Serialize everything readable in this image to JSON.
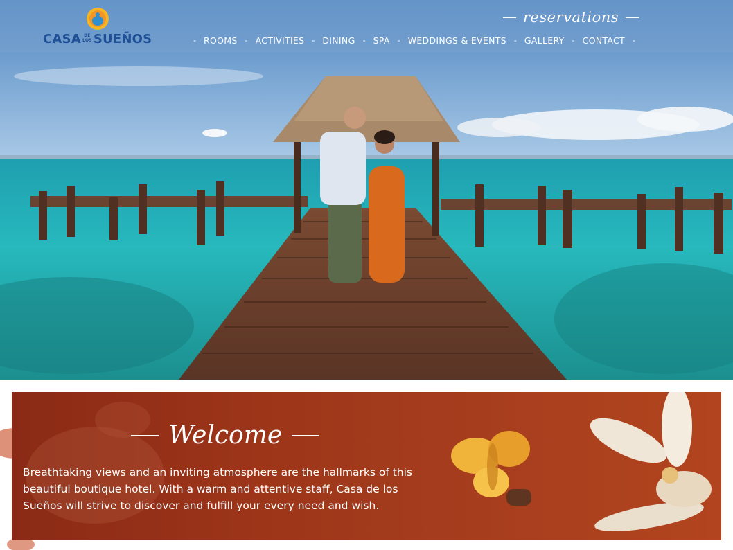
{
  "header": {
    "logo": {
      "name_left": "CASA",
      "name_small_top": "DE",
      "name_small_bottom": "LOS",
      "name_right": "SUEÑOS"
    },
    "reservations_label": "reservations",
    "nav": [
      {
        "label": "ROOMS"
      },
      {
        "label": "ACTIVITIES"
      },
      {
        "label": "DINING"
      },
      {
        "label": "SPA"
      },
      {
        "label": "WEDDINGS & EVENTS"
      },
      {
        "label": "GALLERY"
      },
      {
        "label": "CONTACT"
      }
    ],
    "nav_separator": "-"
  },
  "welcome": {
    "title": "Welcome",
    "body": "Breathtaking views and an inviting atmosphere are the hallmarks of this beautiful boutique hotel. With a warm and attentive staff, Casa de los Sueños will strive to discover and fulfill your every need and wish."
  },
  "colors": {
    "brand_blue": "#1f4f95",
    "header_overlay": "#78a0cd",
    "sea": "#2bb3b8",
    "welcome_bg": "#9d3519"
  },
  "icons": {
    "logo_mark": "sun-turtle-icon"
  }
}
